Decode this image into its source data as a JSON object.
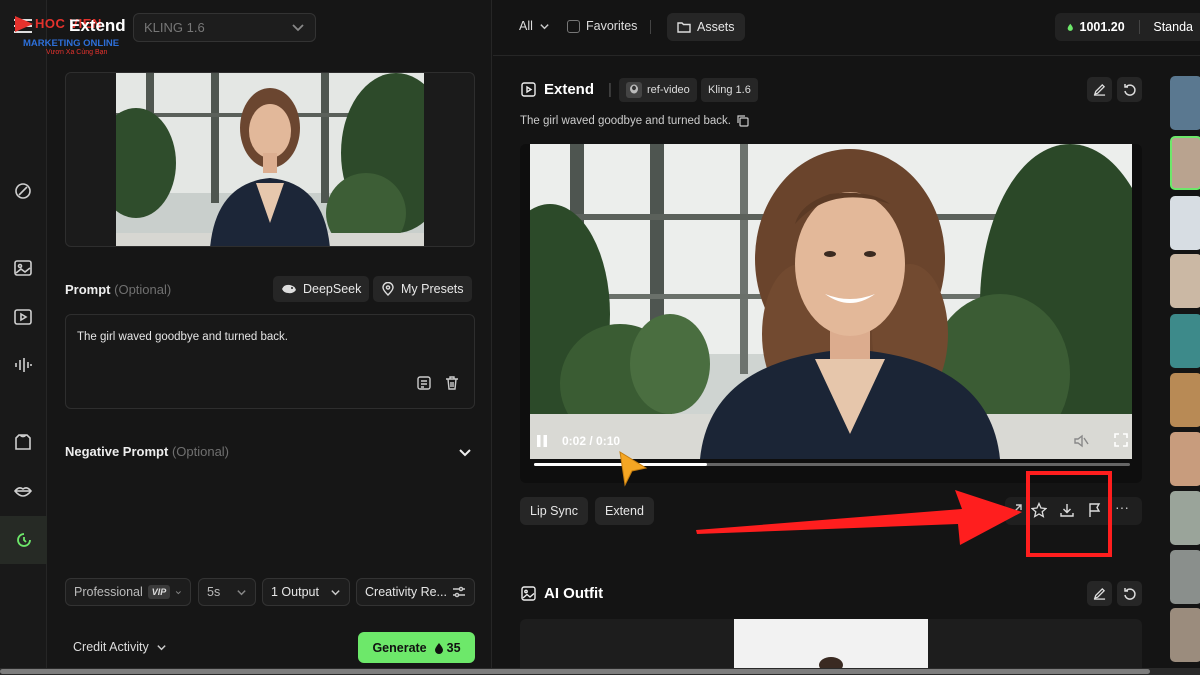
{
  "header": {
    "page_title": "Extend",
    "model_value": "KLING 1.6",
    "logo_line1": "HOC VIEN",
    "logo_line2": "MARKETING ONLINE",
    "logo_line3": "Vươn Xa Cùng Bạn"
  },
  "prompt": {
    "label": "Prompt",
    "optional": "(Optional)",
    "deepseek_label": "DeepSeek",
    "presets_label": "My Presets",
    "text": "The girl waved goodbye and turned back."
  },
  "negative_prompt": {
    "label": "Negative Prompt",
    "optional": "(Optional)"
  },
  "settings": {
    "mode": "Professional",
    "mode_badge": "VIP",
    "duration": "5s",
    "outputs": "1 Output",
    "creativity": "Creativity Re..."
  },
  "footer": {
    "credit_activity": "Credit Activity",
    "generate_label": "Generate",
    "generate_cost": "35"
  },
  "topbar": {
    "filter_all": "All",
    "favorites": "Favorites",
    "assets": "Assets",
    "credits": "1001.20",
    "plan": "Standa"
  },
  "result1": {
    "title": "Extend",
    "tag_ref": "ref-video",
    "tag_model": "Kling 1.6",
    "description": "The girl waved goodbye and turned back.",
    "time": "0:02 / 0:10",
    "progress": 0.29,
    "lip_sync": "Lip Sync",
    "extend": "Extend",
    "more": "···"
  },
  "result2": {
    "title": "AI Outfit"
  },
  "colors": {
    "accent_green": "#6de86a",
    "annotation_red": "#ff1e1e",
    "cursor_orange": "#f5a623"
  }
}
